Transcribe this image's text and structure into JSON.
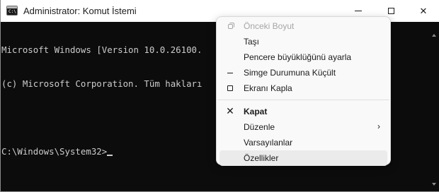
{
  "window": {
    "title": "Administrator: Komut İstemi",
    "app_icon_text": "C:\\",
    "close_glyph": "✕"
  },
  "console": {
    "lines": [
      "Microsoft Windows [Version 10.0.26100.",
      "(c) Microsoft Corporation. Tüm hakları",
      "",
      "C:\\Windows\\System32>"
    ]
  },
  "menu": {
    "items": [
      {
        "label": "Önceki Boyut",
        "icon": "restore-icon",
        "disabled": true
      },
      {
        "label": "Taşı"
      },
      {
        "label": "Pencere büyüklüğünü ayarla"
      },
      {
        "label": "Simge Durumuna Küçült",
        "icon": "minimize-icon"
      },
      {
        "label": "Ekranı Kapla",
        "icon": "maximize-icon"
      },
      {
        "label": "Kapat",
        "icon": "close-icon",
        "icon_glyph": "✕",
        "bold": true
      },
      {
        "label": "Düzenle",
        "submenu_glyph": "›"
      },
      {
        "label": "Varsayılanlar"
      },
      {
        "label": "Özellikler",
        "hovered": true
      }
    ]
  },
  "colors": {
    "console_bg": "#0c0c0c",
    "console_fg": "#cccccc",
    "menu_bg": "#f9f9f9",
    "menu_hover": "#ebebeb",
    "disabled_text": "#a6a6a6"
  }
}
